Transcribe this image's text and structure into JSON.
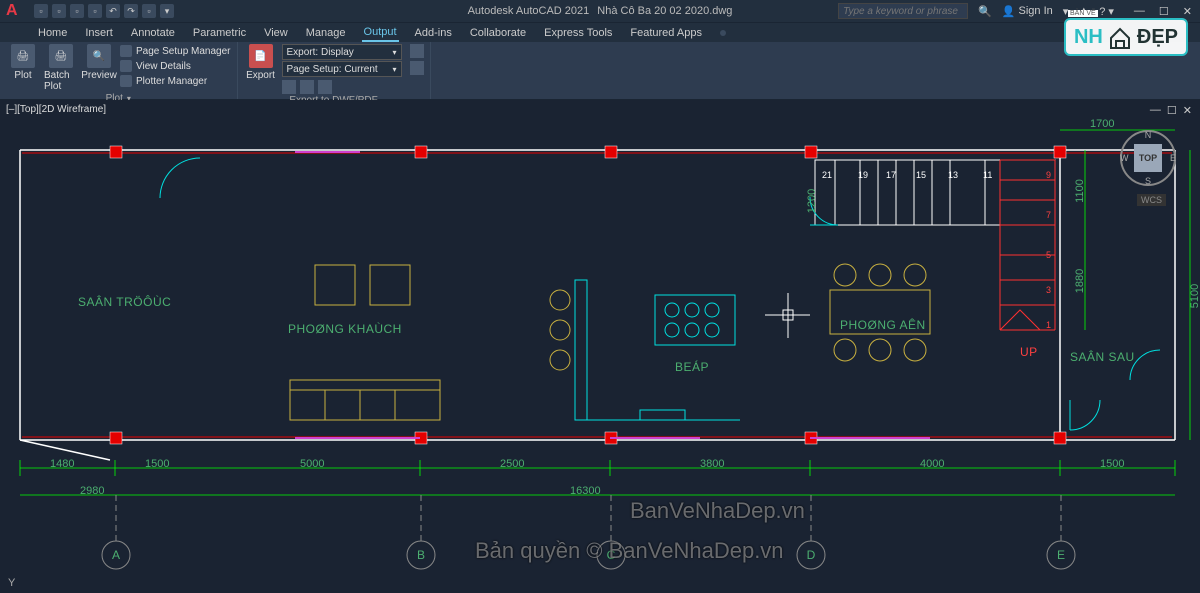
{
  "titlebar": {
    "app": "Autodesk AutoCAD 2021",
    "file": "Nhà Cô Ba 20 02 2020.dwg",
    "search_placeholder": "Type a keyword or phrase",
    "signin": "Sign In"
  },
  "tabs": {
    "items": [
      "Home",
      "Insert",
      "Annotate",
      "Parametric",
      "View",
      "Manage",
      "Output",
      "Add-ins",
      "Collaborate",
      "Express Tools",
      "Featured Apps"
    ],
    "active": "Output"
  },
  "ribbon": {
    "plot": {
      "plot_label": "Plot",
      "batch_label": "Batch Plot",
      "preview_label": "Preview",
      "psm": "Page Setup Manager",
      "vd": "View Details",
      "pm": "Plotter Manager",
      "group": "Plot"
    },
    "export": {
      "export_label": "Export",
      "export_display": "Export: Display",
      "page_setup": "Page Setup: Current",
      "group": "Export to DWF/PDF"
    }
  },
  "viewport": {
    "label": "[–][Top][2D Wireframe]",
    "viewcube_face": "TOP",
    "wcs": "WCS"
  },
  "rooms": {
    "san_truoc": "SAÂN TRÖÔÙC",
    "phong_khach": "PHOØNG KHAÙCH",
    "bep": "BEÁP",
    "phong_an": "PHOØNG AÊN",
    "san_sau": "SAÂN SAU",
    "up": "UP"
  },
  "dimensions": {
    "d1700": "1700",
    "d1200": "1200",
    "d1100": "1100",
    "d1880": "1880",
    "d5100": "5100",
    "d1480": "1480",
    "d1500a": "1500",
    "d2980": "2980",
    "d5000": "5000",
    "d2500": "2500",
    "d3800": "3800",
    "d4000": "4000",
    "d1500b": "1500",
    "d16300": "16300"
  },
  "steps": {
    "s21": "21",
    "s19": "19",
    "s17": "17",
    "s15": "15",
    "s13": "13",
    "s11": "11",
    "s9": "9",
    "s7": "7",
    "s5": "5",
    "s3": "3",
    "s1": "1"
  },
  "grids": {
    "a": "A",
    "b": "B",
    "c": "C",
    "d": "D",
    "e": "E"
  },
  "watermarks": {
    "w1": "BanVeNhaDep.vn",
    "w2": "Bản quyền © BanVeNhaDep.vn"
  },
  "brand": {
    "small": "BẢN VẼ",
    "nha": "NH",
    "dep": "ĐẸP"
  },
  "y": "Y"
}
